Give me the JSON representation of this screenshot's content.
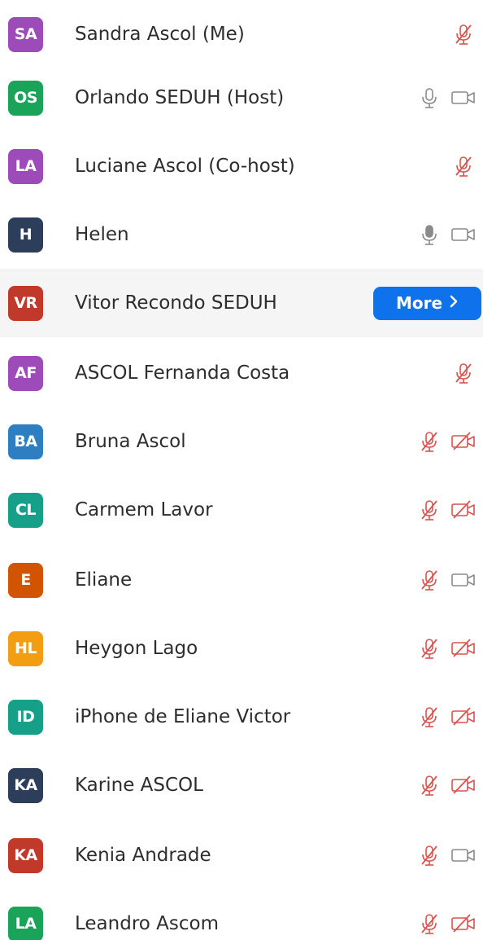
{
  "colors": {
    "purple": "#9c4bb8",
    "green": "#1aa45a",
    "navy": "#2c3e5a",
    "red": "#c0392b",
    "blue": "#2e7fc2",
    "teal": "#17a089",
    "orange": "#d35400",
    "amber": "#f29d12",
    "button_blue": "#0e72ed",
    "muted_red": "#d9534f",
    "icon_gray": "#8a8a8a"
  },
  "participants": [
    {
      "initials": "SA",
      "name": "Sandra Ascol (Me)",
      "color": "#9c4bb8",
      "mic": "muted",
      "video": "none"
    },
    {
      "initials": "OS",
      "name": "Orlando SEDUH (Host)",
      "color": "#1aa45a",
      "mic": "on",
      "video": "on"
    },
    {
      "initials": "LA",
      "name": "Luciane Ascol (Co-host)",
      "color": "#9c4bb8",
      "mic": "muted",
      "video": "none"
    },
    {
      "initials": "H",
      "name": "Helen",
      "color": "#2c3e5a",
      "mic": "on-filled",
      "video": "on"
    },
    {
      "initials": "VR",
      "name": "Vitor Recondo SEDUH",
      "color": "#c0392b",
      "mic": "none",
      "video": "none",
      "more_label": "More"
    },
    {
      "initials": "AF",
      "name": "ASCOL Fernanda Costa",
      "color": "#9c4bb8",
      "mic": "muted",
      "video": "none"
    },
    {
      "initials": "BA",
      "name": "Bruna Ascol",
      "color": "#2e7fc2",
      "mic": "muted",
      "video": "off"
    },
    {
      "initials": "CL",
      "name": "Carmem Lavor",
      "color": "#17a089",
      "mic": "muted",
      "video": "off"
    },
    {
      "initials": "E",
      "name": "Eliane",
      "color": "#d35400",
      "mic": "muted",
      "video": "on"
    },
    {
      "initials": "HL",
      "name": "Heygon Lago",
      "color": "#f29d12",
      "mic": "muted",
      "video": "off"
    },
    {
      "initials": "ID",
      "name": "iPhone de Eliane Victor",
      "color": "#17a089",
      "mic": "muted",
      "video": "off"
    },
    {
      "initials": "KA",
      "name": "Karine ASCOL",
      "color": "#2c3e5a",
      "mic": "muted",
      "video": "off"
    },
    {
      "initials": "KA",
      "name": "Kenia Andrade",
      "color": "#c0392b",
      "mic": "muted",
      "video": "on"
    },
    {
      "initials": "LA",
      "name": "Leandro Ascom",
      "color": "#1aa45a",
      "mic": "muted",
      "video": "off"
    }
  ]
}
